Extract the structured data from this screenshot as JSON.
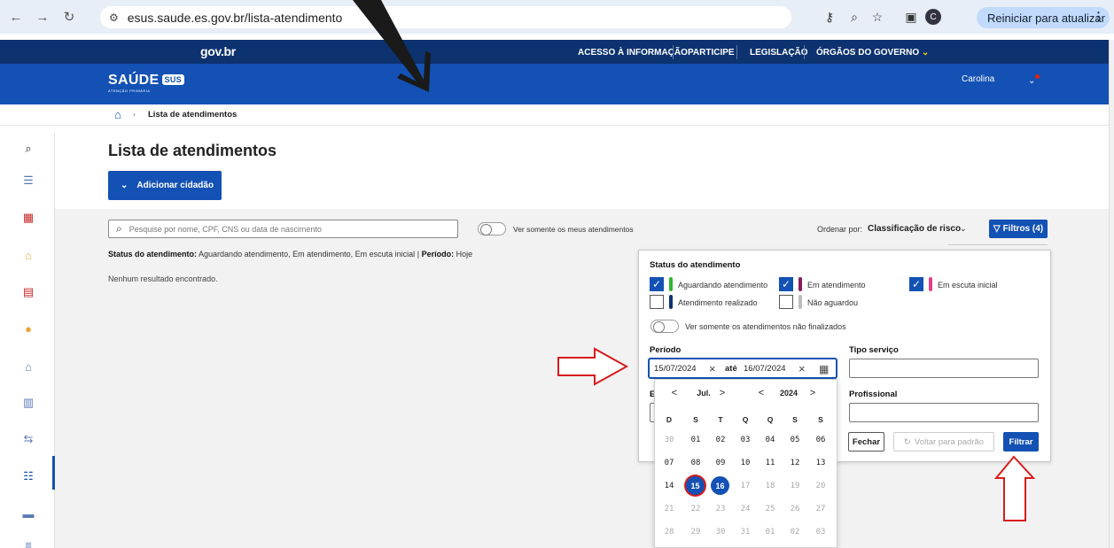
{
  "browser": {
    "url": "esus.saude.es.gov.br/lista-atendimento",
    "update_label": "Reiniciar para atualizar",
    "menu_dots": "⋮",
    "profile_initial": "C"
  },
  "gov": {
    "logo": "gov.br",
    "links": [
      "ACESSO À INFORMAÇÃO",
      "PARTICIPE",
      "LEGISLAÇÃO",
      "ÓRGÃOS DO GOVERNO"
    ]
  },
  "header": {
    "logo": "SAÚDE",
    "logo_badge": "SUS",
    "logo_sub": "ATENÇÃO PRIMÁRIA",
    "user": "Carolina"
  },
  "breadcrumb": {
    "label": "Lista de atendimentos",
    "sep": "›"
  },
  "page": {
    "title": "Lista de atendimentos",
    "add_button": "Adicionar cidadão",
    "search_placeholder": "Pesquise por nome, CPF, CNS ou data de nascimento",
    "toggle_label": "Ver somente os meus atendimentos",
    "order_label": "Ordenar por:",
    "order_value": "Classificação de risco",
    "filters_button": "Filtros (4)",
    "status_label": "Status do atendimento:",
    "status_value": "Aguardando atendimento, Em atendimento, Em escuta inicial",
    "status_sep": "|",
    "periodo_label": "Período:",
    "periodo_value": "Hoje",
    "no_result": "Nenhum resultado encontrado."
  },
  "filter": {
    "status_title": "Status do atendimento",
    "statuses": [
      {
        "label": "Aguardando atendimento",
        "checked": true,
        "color": "#2eb82e"
      },
      {
        "label": "Em atendimento",
        "checked": true,
        "color": "#8a1c5a"
      },
      {
        "label": "Em escuta inicial",
        "checked": true,
        "color": "#e0408a"
      },
      {
        "label": "Atendimento realizado",
        "checked": false,
        "color": "#0c326f"
      },
      {
        "label": "Não aguardou",
        "checked": false,
        "color": "#bdbdbd"
      }
    ],
    "toggle_label": "Ver somente os atendimentos não finalizados",
    "periodo_title": "Período",
    "date_from": "15/07/2024",
    "date_sep": "até",
    "date_to": "16/07/2024",
    "tipo_servico_title": "Tipo serviço",
    "hidden_label_initial": "E",
    "profissional_title": "Profissional",
    "btn_close": "Fechar",
    "btn_reset": "Voltar para padrão",
    "btn_apply": "Filtrar"
  },
  "calendar": {
    "month": "Jul.",
    "year": "2024",
    "prev": "<",
    "next": ">",
    "weekdays": [
      "D",
      "S",
      "T",
      "Q",
      "Q",
      "S",
      "S"
    ],
    "weeks": [
      [
        "30",
        "01",
        "02",
        "03",
        "04",
        "05",
        "06"
      ],
      [
        "07",
        "08",
        "09",
        "10",
        "11",
        "12",
        "13"
      ],
      [
        "14",
        "15",
        "16",
        "17",
        "18",
        "19",
        "20"
      ],
      [
        "21",
        "22",
        "23",
        "24",
        "25",
        "26",
        "27"
      ],
      [
        "28",
        "29",
        "30",
        "31",
        "01",
        "02",
        "03"
      ]
    ],
    "selected_start": "15",
    "selected_end": "16"
  }
}
